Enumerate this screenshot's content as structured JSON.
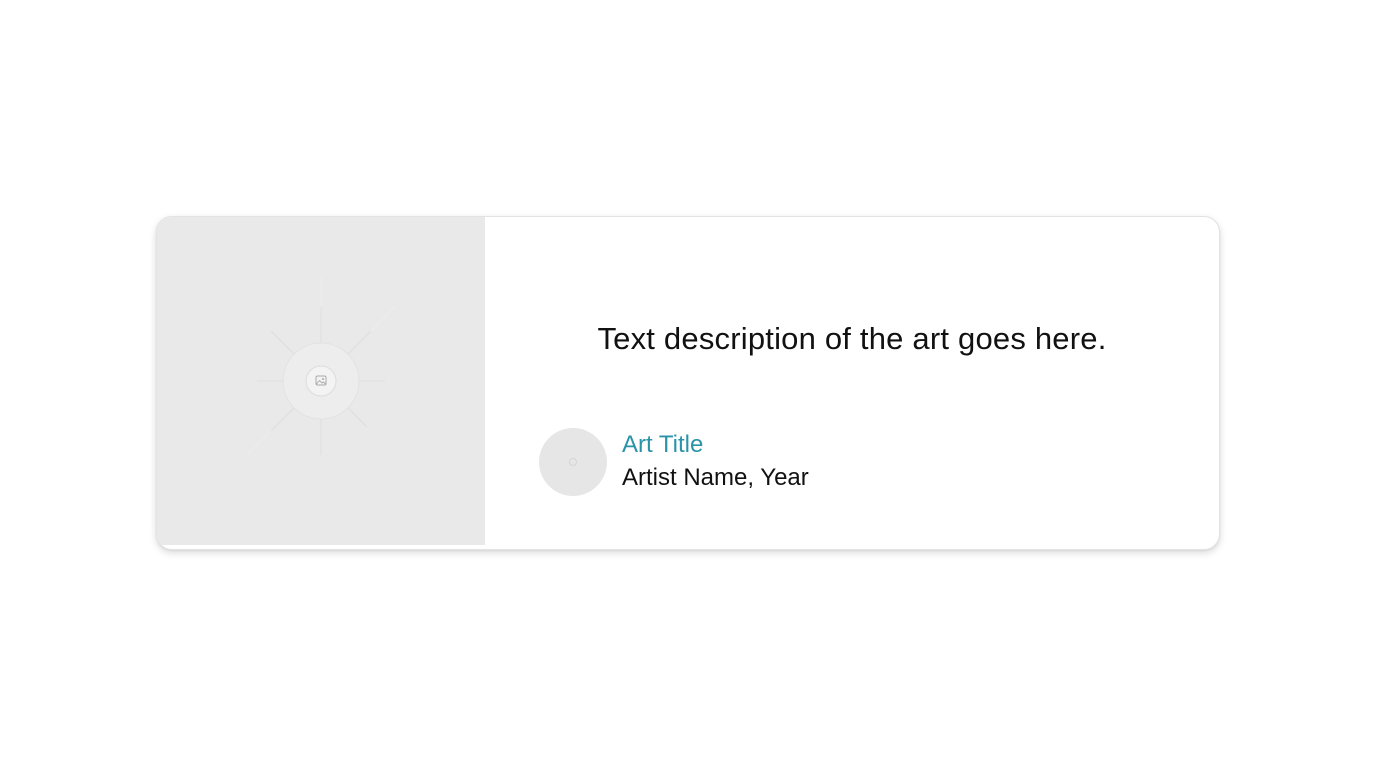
{
  "card": {
    "image": {
      "icon": "image-icon"
    },
    "description": "Text description of the art goes here.",
    "art_title": "Art Title",
    "artist_line": "Artist Name, Year",
    "avatar": {
      "icon": "avatar-placeholder"
    }
  },
  "colors": {
    "accent": "#2a93a8",
    "image_placeholder_bg": "#e9e9e9",
    "text": "#111111"
  }
}
